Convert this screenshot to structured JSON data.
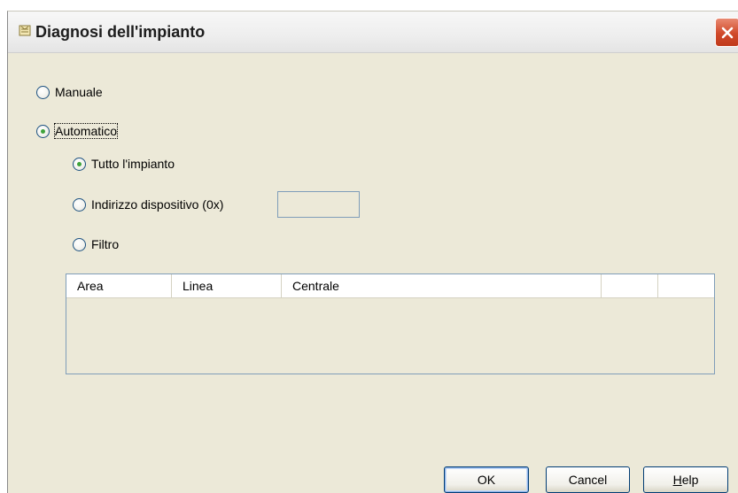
{
  "window": {
    "title": "Diagnosi dell'impianto",
    "icon": "dialog-icon",
    "close_icon": "close-icon"
  },
  "options": {
    "manual_label": "Manuale",
    "manual_selected": false,
    "automatic_label": "Automatico",
    "automatic_selected": true,
    "sub_options": {
      "whole_system_label": "Tutto l'impianto",
      "whole_system_selected": true,
      "device_address_label": "Indirizzo dispositivo (0x)",
      "device_address_selected": false,
      "device_address_value": "",
      "filter_label": "Filtro",
      "filter_selected": false
    }
  },
  "filter_table": {
    "columns": [
      "Area",
      "Linea",
      "Centrale",
      "",
      ""
    ],
    "rows": []
  },
  "buttons": {
    "ok_label": "OK",
    "cancel_label": "Cancel",
    "help_label": "Help",
    "help_mnemonic": "H",
    "help_rest": "elp"
  },
  "colors": {
    "dialog_background": "#ece9d8",
    "radio_checked": "#3fa33b",
    "close_button": "#d0492a",
    "border_blue": "#7f9db9"
  }
}
